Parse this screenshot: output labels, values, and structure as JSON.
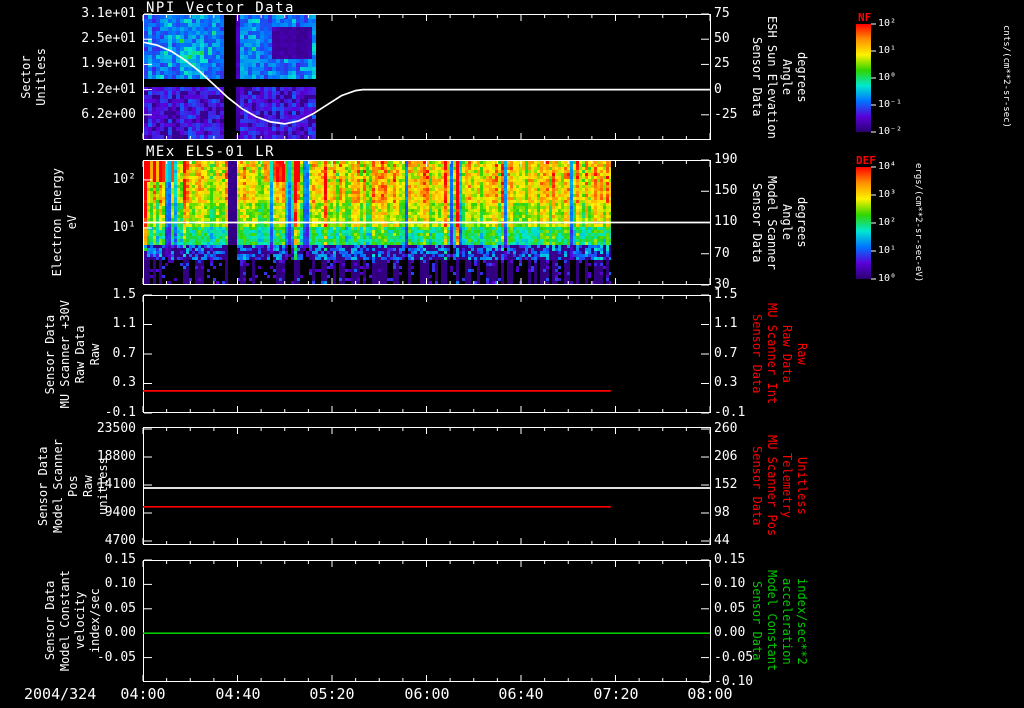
{
  "page": {
    "background": "#000000",
    "date_label": "2004/324"
  },
  "titles": {
    "panel1": "NPI Vector Data",
    "panel2": "MEx ELS-01 LR"
  },
  "xaxis": {
    "tick_labels": [
      "04:00",
      "04:40",
      "05:20",
      "06:00",
      "06:40",
      "07:20",
      "08:00"
    ],
    "range_hours": [
      4.0,
      8.0
    ]
  },
  "panels": [
    {
      "name": "sector",
      "left_label_lines": [
        "Sector",
        "Unitless"
      ],
      "left_ticks": [
        "3.1e+01",
        "2.5e+01",
        "1.9e+01",
        "1.2e+01",
        "6.2e+00"
      ],
      "right_ticks": [
        "75",
        "50",
        "25",
        "0",
        "-25"
      ],
      "right_label_lines": [
        "Sensor Data",
        "ESH Sun Elevation",
        "Angle",
        "degrees"
      ],
      "right_label_color": "#ffffff"
    },
    {
      "name": "els",
      "left_label_lines": [
        "Electron Energy",
        "eV"
      ],
      "left_ticks": [
        "10²",
        "10¹"
      ],
      "right_ticks": [
        "190",
        "150",
        "110",
        "70",
        "30"
      ],
      "right_label_lines": [
        "Sensor Data",
        "Model Scanner",
        "Angle",
        "degrees"
      ],
      "right_label_color": "#ffffff"
    },
    {
      "name": "mu-scanner-30v",
      "left_label_lines": [
        "Sensor Data",
        "MU Scanner +30V",
        "Raw Data",
        "Raw"
      ],
      "left_ticks": [
        "1.5",
        "1.1",
        "0.7",
        "0.3",
        "-0.1"
      ],
      "right_ticks": [
        "1.5",
        "1.1",
        "0.7",
        "0.3",
        "-0.1"
      ],
      "right_label_lines": [
        "Sensor Data",
        "MU Scanner Int",
        "Raw Data",
        "Raw"
      ],
      "right_label_color": "#ff0000"
    },
    {
      "name": "model-scanner-pos",
      "left_label_lines": [
        "Sensor Data",
        "Model Scanner Pos",
        "Raw",
        "unitless"
      ],
      "left_ticks": [
        "23500",
        "18800",
        "14100",
        "9400",
        "4700"
      ],
      "right_ticks": [
        "260",
        "206",
        "152",
        "98",
        "44"
      ],
      "right_label_lines": [
        "Sensor Data",
        "MU Scanner Pos",
        "Telemetry",
        "Unitless"
      ],
      "right_label_color": "#ff0000"
    },
    {
      "name": "model-constant",
      "left_label_lines": [
        "Sensor Data",
        "Model Constant",
        "velocity",
        "index/sec"
      ],
      "left_ticks": [
        "0.15",
        "0.10",
        "0.05",
        "0.00",
        "-0.05"
      ],
      "right_ticks": [
        "0.15",
        "0.10",
        "0.05",
        "0.00",
        "-0.05",
        "-0.10"
      ],
      "right_label_lines": [
        "Sensor Data",
        "Model Constant",
        "acceleration",
        "index/sec**2"
      ],
      "right_label_color": "#00c800"
    }
  ],
  "colorbars": [
    {
      "title": "NF",
      "ticks": [
        "10²",
        "10¹",
        "10⁰",
        "10⁻¹",
        "10⁻²"
      ],
      "unit": "cnts/(cm**2-sr-sec)"
    },
    {
      "title": "DEF",
      "ticks": [
        "10⁴",
        "10³",
        "10²",
        "10¹",
        "10⁰"
      ],
      "unit": "ergs/(cm**2-sr-sec-eV)"
    }
  ],
  "style": {
    "background": "#000000",
    "foreground": "#ffffff",
    "red": "#ff0000",
    "green": "#00c800",
    "spectral_palette": [
      "#ff0000",
      "#ff9100",
      "#fdf200",
      "#2fd400",
      "#00e8d0",
      "#0073ff",
      "#5a00d8",
      "#2a0070"
    ]
  },
  "chart_data": [
    {
      "type": "heatmap",
      "title": "NPI Vector Data",
      "x_axis": {
        "range_hours": [
          4.0,
          8.0
        ],
        "tick_labels": [
          "04:00",
          "04:40",
          "05:20",
          "06:00",
          "06:40",
          "07:20",
          "08:00"
        ],
        "date": "2004/324"
      },
      "y_left": {
        "label": "Sector Unitless",
        "range": [
          0,
          31
        ],
        "ticks": [
          31,
          24.8,
          18.6,
          12.4,
          6.2
        ]
      },
      "y_right": {
        "label": "Sensor Data ESH Sun Elevation Angle degrees",
        "range": [
          -50,
          75
        ],
        "ticks": [
          75,
          50,
          25,
          0,
          -25
        ]
      },
      "heatmap": {
        "x_extent_hours": [
          4.0,
          5.22
        ],
        "colorbar": "NF",
        "description": "low-intensity blue/purple NPI sector counts; black data-gap column near 4.56-4.64 h and black horizontal band across mid sectors"
      },
      "overlay_series": [
        {
          "name": "ESH Sun Elevation Angle",
          "color": "#ffffff",
          "axis": "right",
          "points_hours_value": [
            [
              4.0,
              47
            ],
            [
              4.1,
              44
            ],
            [
              4.2,
              38
            ],
            [
              4.3,
              29
            ],
            [
              4.4,
              18
            ],
            [
              4.5,
              5
            ],
            [
              4.6,
              -8
            ],
            [
              4.7,
              -19
            ],
            [
              4.8,
              -27
            ],
            [
              4.9,
              -32
            ],
            [
              5.0,
              -34
            ],
            [
              5.1,
              -31
            ],
            [
              5.2,
              -24
            ],
            [
              5.3,
              -15
            ],
            [
              5.4,
              -6
            ],
            [
              5.5,
              -1
            ],
            [
              5.55,
              0
            ],
            [
              8.0,
              0
            ]
          ]
        }
      ]
    },
    {
      "type": "heatmap",
      "title": "MEx ELS-01 LR",
      "y_left": {
        "label": "Electron Energy eV",
        "scale": "log",
        "range": [
          0.65,
          260
        ],
        "ticks": [
          100,
          10
        ]
      },
      "y_right": {
        "label": "Sensor Data Model Scanner Angle degrees",
        "range": [
          30,
          190
        ],
        "ticks": [
          190,
          150,
          110,
          70,
          30
        ]
      },
      "heatmap": {
        "x_extent_hours": [
          4.0,
          7.31
        ],
        "colorbar": "DEF",
        "description": "electron energy-flux spectrogram: intense red/orange at high energies early, broad yellow-green band at mid energies, sparse purple speckle at lowest energies"
      },
      "overlay_series": [
        {
          "name": "Model Scanner Angle",
          "color": "#ffffff",
          "axis": "right",
          "points_hours_value": [
            [
              4.0,
              110
            ],
            [
              8.0,
              110
            ]
          ]
        }
      ]
    },
    {
      "type": "line",
      "y_left": {
        "label": "Sensor Data MU Scanner +30V Raw Data Raw",
        "range": [
          -0.1,
          1.5
        ],
        "ticks": [
          1.5,
          1.1,
          0.7,
          0.3,
          -0.1
        ]
      },
      "y_right": {
        "label": "Sensor Data MU Scanner Int Raw Data Raw",
        "range": [
          -0.1,
          1.5
        ],
        "ticks": [
          1.5,
          1.1,
          0.7,
          0.3,
          -0.1
        ]
      },
      "series": [
        {
          "name": "MU Scanner Int Raw",
          "color": "#ff0000",
          "axis": "right",
          "points_hours_value": [
            [
              4.0,
              0.2
            ],
            [
              7.3,
              0.2
            ]
          ]
        }
      ]
    },
    {
      "type": "line",
      "y_left": {
        "label": "Sensor Data Model Scanner Pos Raw unitless",
        "range": [
          4028,
          23836
        ],
        "ticks": [
          23500,
          18800,
          14100,
          9400,
          4700
        ]
      },
      "y_right": {
        "label": "Sensor Data MU Scanner Pos Telemetry Unitless",
        "range": [
          36.3,
          263.9
        ],
        "ticks": [
          260,
          206,
          152,
          98,
          44
        ]
      },
      "series": [
        {
          "name": "Model Scanner Pos Raw",
          "color": "#ffffff",
          "axis": "left",
          "points_hours_value": [
            [
              4.0,
              13600
            ],
            [
              8.0,
              13600
            ]
          ]
        },
        {
          "name": "MU Scanner Pos Telemetry",
          "color": "#ff0000",
          "axis": "right",
          "points_hours_value": [
            [
              4.0,
              110
            ],
            [
              7.3,
              110
            ]
          ]
        }
      ]
    },
    {
      "type": "line",
      "y_left": {
        "label": "Sensor Data Model Constant velocity index/sec",
        "range": [
          -0.1,
          0.15
        ],
        "ticks": [
          0.15,
          0.1,
          0.05,
          0.0,
          -0.05
        ]
      },
      "y_right": {
        "label": "Sensor Data Model Constant acceleration index/sec**2",
        "range": [
          -0.1,
          0.15
        ],
        "ticks": [
          0.15,
          0.1,
          0.05,
          0.0,
          -0.05,
          -0.1
        ]
      },
      "series": [
        {
          "name": "Model Constant velocity",
          "color": "#00c800",
          "axis": "left",
          "points_hours_value": [
            [
              4.0,
              0.0
            ],
            [
              8.0,
              0.0
            ]
          ]
        }
      ]
    }
  ]
}
